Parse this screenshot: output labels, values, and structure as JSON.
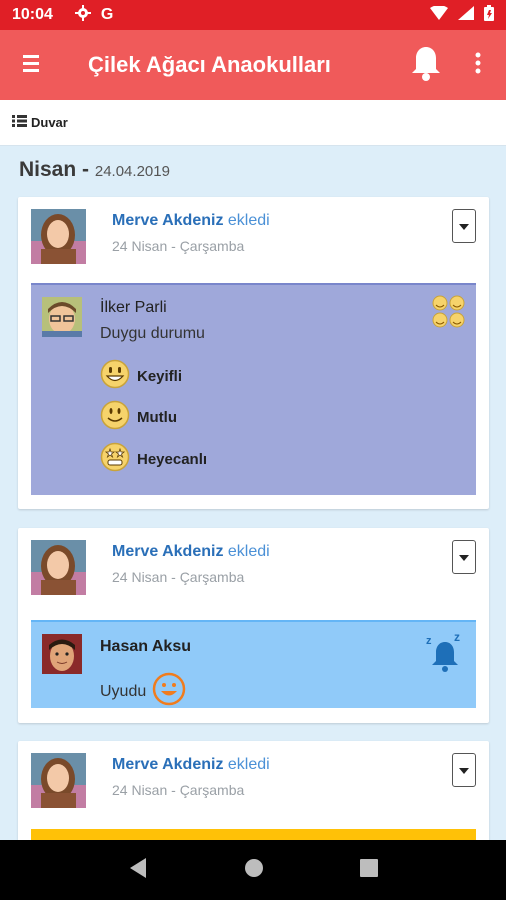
{
  "status_bar": {
    "time": "10:04",
    "g_label": "G"
  },
  "app_bar": {
    "title": "Çilek Ağacı Anaokulları"
  },
  "sub_bar": {
    "wall_label": "Duvar"
  },
  "feed": {
    "month": "Nisan",
    "separator": " - ",
    "date": "24.04.2019",
    "posts": [
      {
        "author": "Merve Akdeniz",
        "verb": "ekledi",
        "subtitle": "24 Nisan - Çarşamba",
        "kid": "İlker Parli",
        "label": "Duygu durumu",
        "moods": [
          "Keyifli",
          "Mutlu",
          "Heyecanlı"
        ]
      },
      {
        "author": "Merve Akdeniz",
        "verb": "ekledi",
        "subtitle": "24 Nisan - Çarşamba",
        "kid": "Hasan Aksu",
        "label": "Uyudu"
      },
      {
        "author": "Merve Akdeniz",
        "verb": "ekledi",
        "subtitle": "24 Nisan - Çarşamba"
      }
    ]
  },
  "colors": {
    "status_bar": "#e01f26",
    "app_bar": "#f05a5a",
    "mood_panel": "#9fa8da",
    "sleep_panel": "#90caf9",
    "yellow_panel": "#ffc107",
    "author_link": "#2a6fb8"
  },
  "icons": {
    "menu": "hamburger-icon",
    "notifications": "bell-icon",
    "more": "more-vert-icon",
    "wall": "list-icon",
    "sleep": "sleep-bell-icon",
    "mood": "emoji-group-icon"
  }
}
